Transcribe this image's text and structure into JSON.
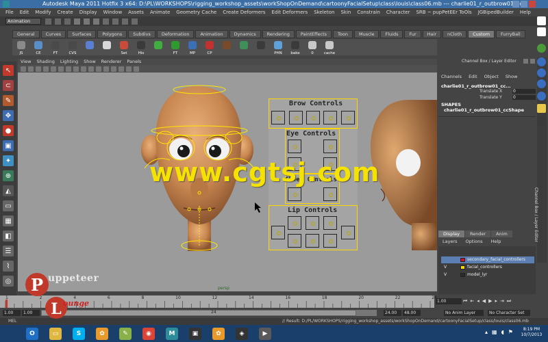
{
  "window": {
    "title": "Autodesk Maya 2011 Hotfix 3 x64: D:\\PL\\WORKSHOPS\\rigging_workshop_assets\\workShopOnDemand\\cartoonyFacialSetup\\class\\louis\\class06.mb  ---  charlie01_r_outbrow01_cc..."
  },
  "menubar": [
    "File",
    "Edit",
    "Modify",
    "Create",
    "Display",
    "Window",
    "Assets",
    "Animate",
    "Geometry Cache",
    "Create Deformers",
    "Edit Deformers",
    "Skeleton",
    "Skin",
    "Constrain",
    "Character",
    "SRB ~ pupPetEEr ToOls",
    "JGBipedBuilder",
    "Help"
  ],
  "mode": "Animation",
  "shelf_tabs": [
    "General",
    "Curves",
    "Surfaces",
    "Polygons",
    "Subdivs",
    "Deformation",
    "Animation",
    "Dynamics",
    "Rendering",
    "PaintEffects",
    "Toon",
    "Muscle",
    "Fluids",
    "Fur",
    "Hair",
    "nCloth",
    "Custom",
    "FurryBall"
  ],
  "shelf_active": "Custom",
  "shelf_buttons": [
    {
      "label": "JS",
      "color": "#8a8a8a"
    },
    {
      "label": "CE",
      "color": "#5a8ec8"
    },
    {
      "label": "FT",
      "color": "#4a4a4a"
    },
    {
      "label": "CVS",
      "color": "#4a4a4a"
    },
    {
      "label": "",
      "color": "#5a7fd0"
    },
    {
      "label": "",
      "color": "#d8d8d8"
    },
    {
      "label": "Set",
      "color": "#c94c3a"
    },
    {
      "label": "His",
      "color": "#3a3a3a"
    },
    {
      "label": "",
      "color": "#3fae3f"
    },
    {
      "label": "FT",
      "color": "#2f9a2f"
    },
    {
      "label": "MP",
      "color": "#3a6fb8"
    },
    {
      "label": "CP",
      "color": "#c23030"
    },
    {
      "label": "",
      "color": "#7a4a2a"
    },
    {
      "label": "",
      "color": "#3f8f5a"
    },
    {
      "label": "",
      "color": "#3a3a3a"
    },
    {
      "label": "PHN",
      "color": "#5fa0d8"
    },
    {
      "label": "bake",
      "color": "#3a3a3a"
    },
    {
      "label": "0",
      "color": "#c8c8c8"
    },
    {
      "label": "cache",
      "color": "#c8c8c8"
    }
  ],
  "viewport": {
    "menu": [
      "View",
      "Shading",
      "Lighting",
      "Show",
      "Renderer",
      "Panels"
    ],
    "camera_label": "persp"
  },
  "control_panel": {
    "brow_title": "Brow Controls",
    "eye_title": "Eye Controls",
    "cheek_title": "Cheek Controls",
    "lip_title": "Lip Controls"
  },
  "channel_box": {
    "title": "Channel Box / Layer Editor",
    "menu": [
      "Channels",
      "Edit",
      "Object",
      "Show"
    ],
    "object_name": "charlie01_r_outbrow01_cc...",
    "attrs": [
      {
        "name": "Translate X",
        "value": "0"
      },
      {
        "name": "Translate Y",
        "value": "0"
      }
    ],
    "shapes_header": "SHAPES",
    "shape_name": "charlie01_r_outbrow01_ccShape",
    "side_label": "Channel Box / Layer Editor"
  },
  "layer_editor": {
    "tabs": [
      "Display",
      "Render",
      "Anim"
    ],
    "active_tab": "Display",
    "menu": [
      "Layers",
      "Options",
      "Help"
    ],
    "layers": [
      {
        "visible": "",
        "color": "#c8102e",
        "name": "secondary_facial_controllers",
        "selected": true
      },
      {
        "visible": "V",
        "color": "#ffd700",
        "name": "facial_controllers",
        "selected": false
      },
      {
        "visible": "V",
        "color": "#2b2b2b",
        "name": "model_lyr",
        "selected": false
      }
    ]
  },
  "timeline": {
    "ticks": [
      "1",
      "2",
      "4",
      "6",
      "8",
      "10",
      "12",
      "14",
      "16",
      "18",
      "20",
      "22",
      "24"
    ],
    "current_time": "1.00",
    "start": "1.00",
    "range_start": "1.00",
    "range_mid": "24",
    "range_end": "24.00",
    "end": "48.00",
    "anim_layer": "No Anim Layer",
    "char_set": "No Character Set"
  },
  "command_line": {
    "label": "MEL",
    "result": "// Result: D:/PL/WORKSHOPS/rigging_workshop_assets/workShopOnDemand/cartoonyFacialSetup/class/louis/class06.mb"
  },
  "watermark": "www.cgtsj.com",
  "logo": {
    "line1": "uppeteer",
    "line2": "ounge"
  },
  "taskbar": {
    "apps": [
      {
        "icon": "outlook-icon",
        "color": "#1f6fc4",
        "glyph": "O"
      },
      {
        "icon": "explorer-icon",
        "color": "#e0b840",
        "glyph": "▭"
      },
      {
        "icon": "skype-icon",
        "color": "#00aff0",
        "glyph": "S"
      },
      {
        "icon": "flower-icon",
        "color": "#e89a2a",
        "glyph": "✿"
      },
      {
        "icon": "notepad-icon",
        "color": "#8ab04a",
        "glyph": "✎"
      },
      {
        "icon": "chrome-icon",
        "color": "#db4437",
        "glyph": "◉"
      },
      {
        "icon": "maya-icon",
        "color": "#2c8c9a",
        "glyph": "M"
      },
      {
        "icon": "terminal-icon",
        "color": "#333333",
        "glyph": "▣"
      },
      {
        "icon": "flower-icon-2",
        "color": "#e89a2a",
        "glyph": "✿"
      },
      {
        "icon": "capture-icon",
        "color": "#333333",
        "glyph": "◈"
      },
      {
        "icon": "media-icon",
        "color": "#5a5a5a",
        "glyph": "▶"
      }
    ],
    "time": "8:19 PM",
    "date": "10/7/2013"
  }
}
